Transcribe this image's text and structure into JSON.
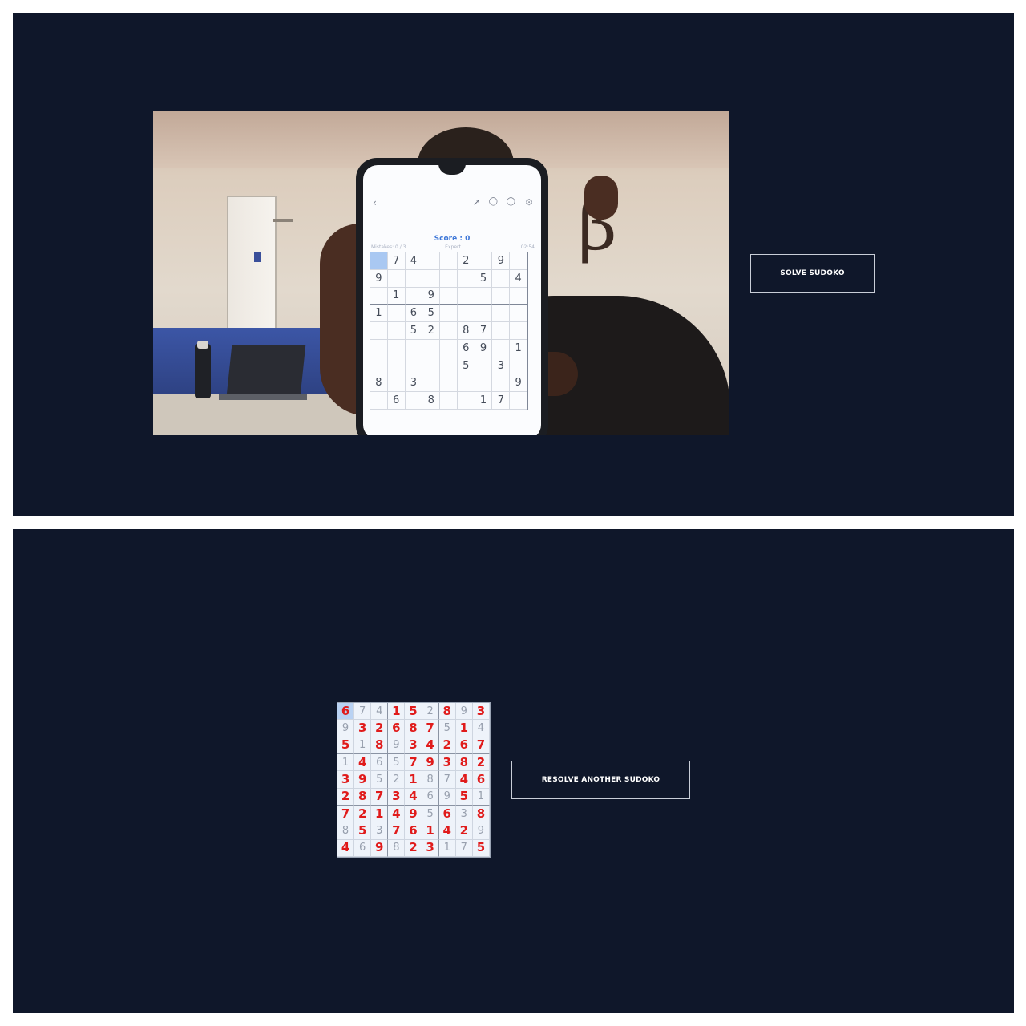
{
  "capture_view": {
    "solve_button_label": "SOLVE SUDOKO",
    "camera_feed": {
      "phone_screen": {
        "score_text": "Score : 0",
        "mistakes_text": "Mistakes: 0 / 3",
        "level_text": "Expert",
        "timer_text": "02:54",
        "puzzle": [
          [
            "",
            "7",
            "4",
            "",
            "",
            "2",
            "",
            "9",
            ""
          ],
          [
            "9",
            "",
            "",
            "",
            "",
            "",
            "5",
            "",
            "4"
          ],
          [
            "",
            "1",
            "",
            "9",
            "",
            "",
            "",
            "",
            ""
          ],
          [
            "1",
            "",
            "6",
            "5",
            "",
            "",
            "",
            "",
            ""
          ],
          [
            "",
            "",
            "5",
            "2",
            "",
            "8",
            "7",
            "",
            ""
          ],
          [
            "",
            "",
            "",
            "",
            "",
            "6",
            "9",
            "",
            "1"
          ],
          [
            "",
            "",
            "",
            "",
            "",
            "5",
            "",
            "3",
            ""
          ],
          [
            "8",
            "",
            "3",
            "",
            "",
            "",
            "",
            "",
            "9"
          ],
          [
            "",
            "6",
            "",
            "8",
            "",
            "",
            "1",
            "7",
            ""
          ]
        ]
      }
    }
  },
  "result_view": {
    "resolve_button_label": "RESOLVE ANOTHER SUDOKO",
    "solution": [
      [
        "6",
        "7",
        "4",
        "1",
        "5",
        "2",
        "8",
        "9",
        "3"
      ],
      [
        "9",
        "3",
        "2",
        "6",
        "8",
        "7",
        "5",
        "1",
        "4"
      ],
      [
        "5",
        "1",
        "8",
        "9",
        "3",
        "4",
        "2",
        "6",
        "7"
      ],
      [
        "1",
        "4",
        "6",
        "5",
        "7",
        "9",
        "3",
        "8",
        "2"
      ],
      [
        "3",
        "9",
        "5",
        "2",
        "1",
        "8",
        "7",
        "4",
        "6"
      ],
      [
        "2",
        "8",
        "7",
        "3",
        "4",
        "6",
        "9",
        "5",
        "1"
      ],
      [
        "7",
        "2",
        "1",
        "4",
        "9",
        "5",
        "6",
        "3",
        "8"
      ],
      [
        "8",
        "5",
        "3",
        "7",
        "6",
        "1",
        "4",
        "2",
        "9"
      ],
      [
        "4",
        "6",
        "9",
        "8",
        "2",
        "3",
        "1",
        "7",
        "5"
      ]
    ],
    "given_mask": [
      [
        0,
        1,
        1,
        0,
        0,
        1,
        0,
        1,
        0
      ],
      [
        1,
        0,
        0,
        0,
        0,
        0,
        1,
        0,
        1
      ],
      [
        0,
        1,
        0,
        1,
        0,
        0,
        0,
        0,
        0
      ],
      [
        1,
        0,
        1,
        1,
        0,
        0,
        0,
        0,
        0
      ],
      [
        0,
        0,
        1,
        1,
        0,
        1,
        1,
        0,
        0
      ],
      [
        0,
        0,
        0,
        0,
        0,
        1,
        1,
        0,
        1
      ],
      [
        0,
        0,
        0,
        0,
        0,
        1,
        0,
        1,
        0
      ],
      [
        1,
        0,
        1,
        0,
        0,
        0,
        0,
        0,
        1
      ],
      [
        0,
        1,
        0,
        1,
        0,
        0,
        1,
        1,
        0
      ]
    ]
  },
  "colors": {
    "panel_background": "#0f172a",
    "solved_digit": "#e01b1b",
    "given_digit": "#98a0ae",
    "button_border": "#c9ced8"
  },
  "icons": [
    "back-icon",
    "share-icon",
    "pause-icon",
    "palette-icon",
    "settings-icon"
  ]
}
